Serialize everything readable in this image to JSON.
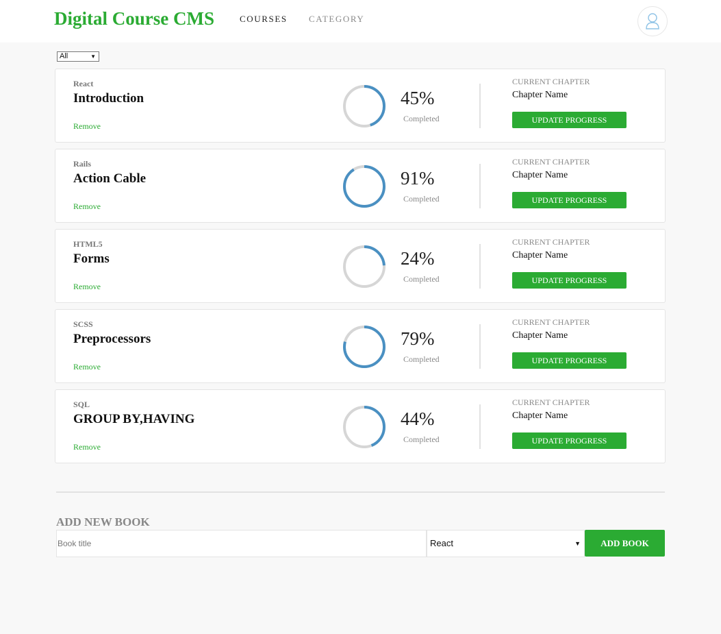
{
  "header": {
    "brand": "Digital Course CMS",
    "nav": [
      "COURSES",
      "CATEGORY"
    ]
  },
  "filter": {
    "selected": "All"
  },
  "courses": [
    {
      "category": "React",
      "title": "Introduction",
      "percent": 45,
      "percent_label": "45%",
      "completed_label": "Completed",
      "remove_label": "Remove",
      "chapter_label": "CURRENT CHAPTER",
      "chapter_name": "Chapter Name",
      "update_label": "UPDATE PROGRESS"
    },
    {
      "category": "Rails",
      "title": "Action Cable",
      "percent": 91,
      "percent_label": "91%",
      "completed_label": "Completed",
      "remove_label": "Remove",
      "chapter_label": "CURRENT CHAPTER",
      "chapter_name": "Chapter Name",
      "update_label": "UPDATE PROGRESS"
    },
    {
      "category": "HTML5",
      "title": "Forms",
      "percent": 24,
      "percent_label": "24%",
      "completed_label": "Completed",
      "remove_label": "Remove",
      "chapter_label": "CURRENT CHAPTER",
      "chapter_name": "Chapter Name",
      "update_label": "UPDATE PROGRESS"
    },
    {
      "category": "SCSS",
      "title": "Preprocessors",
      "percent": 79,
      "percent_label": "79%",
      "completed_label": "Completed",
      "remove_label": "Remove",
      "chapter_label": "CURRENT CHAPTER",
      "chapter_name": "Chapter Name",
      "update_label": "UPDATE PROGRESS"
    },
    {
      "category": "SQL",
      "title": "GROUP BY,HAVING",
      "percent": 44,
      "percent_label": "44%",
      "completed_label": "Completed",
      "remove_label": "Remove",
      "chapter_label": "CURRENT CHAPTER",
      "chapter_name": "Chapter Name",
      "update_label": "UPDATE PROGRESS"
    }
  ],
  "add_book": {
    "heading": "ADD NEW BOOK",
    "title_placeholder": "Book title",
    "category_selected": "React",
    "button_label": "ADD BOOK"
  },
  "colors": {
    "brand": "#2bab33",
    "progress": "#4a90c2",
    "track": "#d6d6d6"
  },
  "icons": {
    "avatar": "user-icon",
    "dropdown": "caret-down-icon"
  }
}
